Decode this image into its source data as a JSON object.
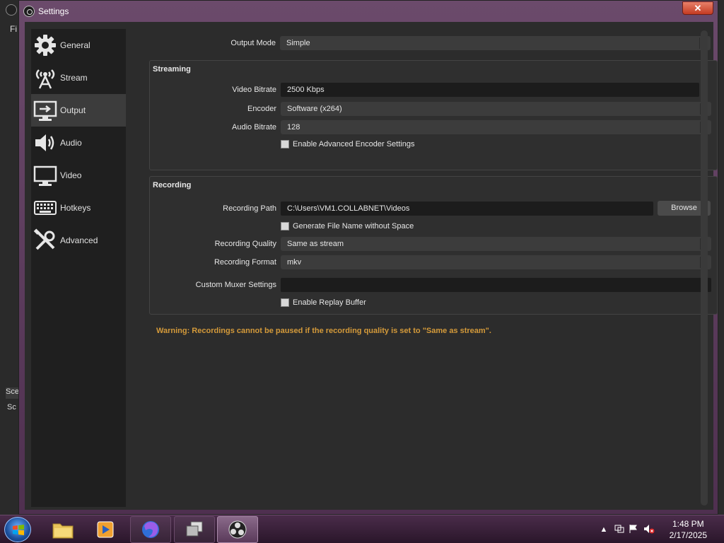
{
  "window": {
    "title": "Settings",
    "close_glyph": "✕"
  },
  "background": {
    "menu_fragment": "Fi",
    "scenes_fragment_1": "Sce",
    "scenes_fragment_2": "Sc"
  },
  "sidebar": {
    "items": [
      {
        "label": "General",
        "icon": "gear-icon"
      },
      {
        "label": "Stream",
        "icon": "broadcast-icon"
      },
      {
        "label": "Output",
        "icon": "output-icon",
        "active": true
      },
      {
        "label": "Audio",
        "icon": "speaker-icon"
      },
      {
        "label": "Video",
        "icon": "monitor-icon"
      },
      {
        "label": "Hotkeys",
        "icon": "keyboard-icon"
      },
      {
        "label": "Advanced",
        "icon": "tools-icon"
      }
    ]
  },
  "output": {
    "mode_label": "Output Mode",
    "mode_value": "Simple",
    "streaming": {
      "title": "Streaming",
      "video_bitrate_label": "Video Bitrate",
      "video_bitrate_value": "2500 Kbps",
      "encoder_label": "Encoder",
      "encoder_value": "Software (x264)",
      "audio_bitrate_label": "Audio Bitrate",
      "audio_bitrate_value": "128",
      "advanced_encoder_label": "Enable Advanced Encoder Settings"
    },
    "recording": {
      "title": "Recording",
      "path_label": "Recording Path",
      "path_value": "C:\\Users\\VM1.COLLABNET\\Videos",
      "browse_label": "Browse",
      "no_space_label": "Generate File Name without Space",
      "quality_label": "Recording Quality",
      "quality_value": "Same as stream",
      "format_label": "Recording Format",
      "format_value": "mkv",
      "muxer_label": "Custom Muxer Settings",
      "muxer_value": "",
      "replay_label": "Enable Replay Buffer"
    },
    "warning": "Warning: Recordings cannot be paused if the recording quality is set to \"Same as stream\"."
  },
  "taskbar": {
    "apps": [
      "file-explorer",
      "media-player",
      "firefox",
      "task-view",
      "obs-studio"
    ],
    "time": "1:48 PM",
    "date": "2/17/2025",
    "tray": [
      "show-hidden-icons",
      "network-icon",
      "action-center-flag-icon",
      "volume-muted-icon"
    ]
  },
  "colors": {
    "warning": "#d49a3a",
    "active_nav": "#3c3c3c",
    "panel": "#2c2c2c"
  }
}
